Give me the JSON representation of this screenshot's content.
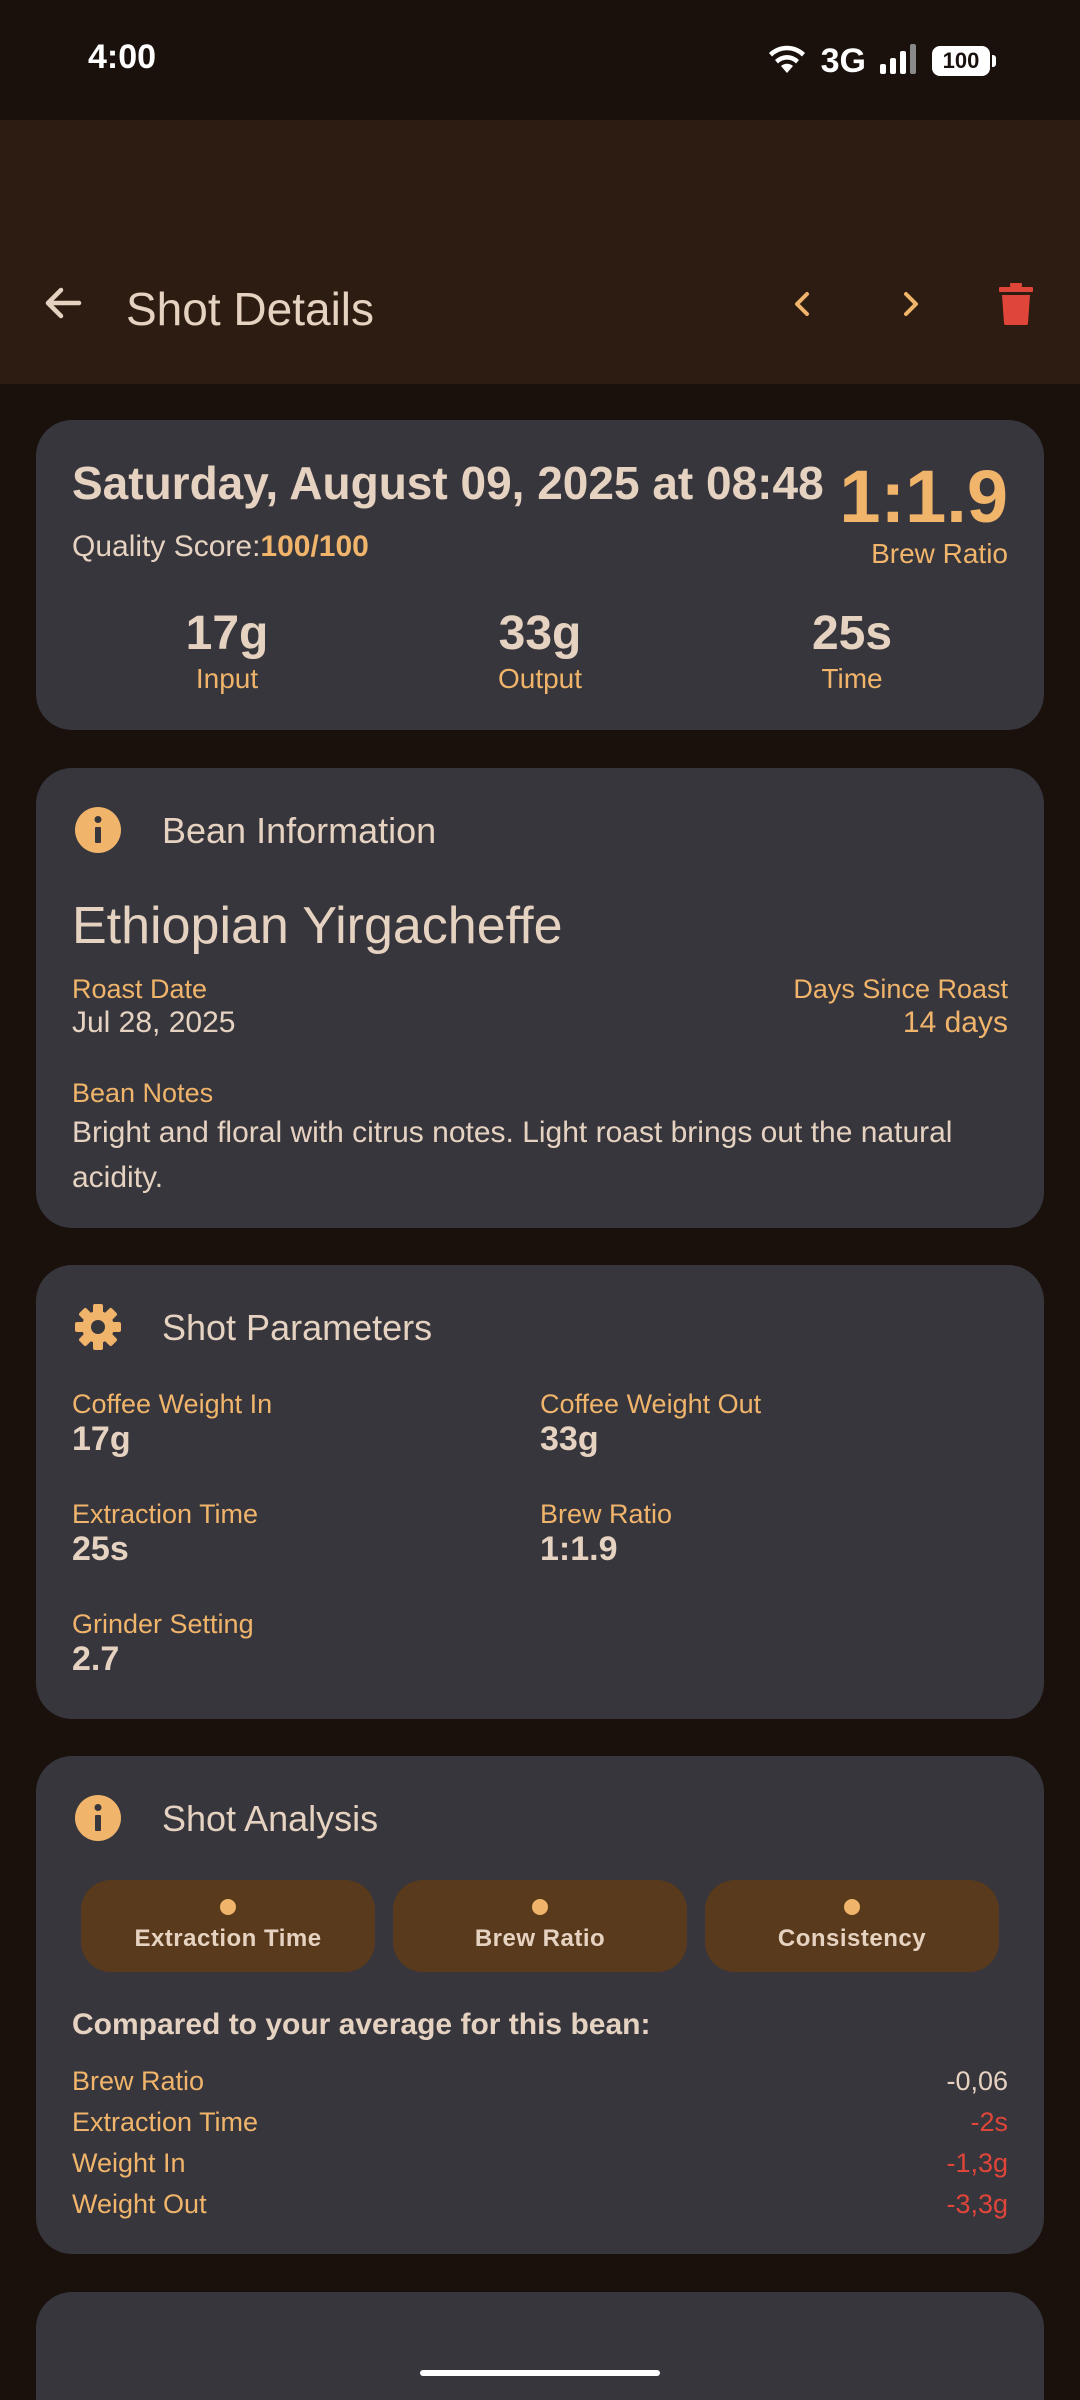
{
  "status": {
    "time": "4:00",
    "network": "3G",
    "battery": "100"
  },
  "app_bar": {
    "title": "Shot Details"
  },
  "summary": {
    "date": "Saturday, August 09, 2025 at 08:48",
    "quality_label": "Quality Score:",
    "quality_value": "100/100",
    "ratio": "1:1.9",
    "ratio_caption": "Brew Ratio",
    "stats": [
      {
        "value": "17g",
        "label": "Input"
      },
      {
        "value": "33g",
        "label": "Output"
      },
      {
        "value": "25s",
        "label": "Time"
      }
    ]
  },
  "bean": {
    "section_title": "Bean Information",
    "name": "Ethiopian Yirgacheffe",
    "roast_date_label": "Roast Date",
    "roast_date": "Jul 28, 2025",
    "days_label": "Days Since Roast",
    "days": "14 days",
    "notes_label": "Bean Notes",
    "notes": "Bright and floral with citrus notes. Light roast brings out the natural acidity."
  },
  "params": {
    "section_title": "Shot Parameters",
    "items": [
      {
        "label": "Coffee Weight In",
        "value": "17g"
      },
      {
        "label": "Coffee Weight Out",
        "value": "33g"
      },
      {
        "label": "Extraction Time",
        "value": "25s"
      },
      {
        "label": "Brew Ratio",
        "value": "1:1.9"
      },
      {
        "label": "Grinder Setting",
        "value": "2.7"
      }
    ]
  },
  "analysis": {
    "section_title": "Shot Analysis",
    "chips": [
      "Extraction Time",
      "Brew Ratio",
      "Consistency"
    ],
    "compare_heading": "Compared to your average for this bean:",
    "rows": [
      {
        "label": "Brew Ratio",
        "value": "-0,06",
        "color": "#e6d2c0"
      },
      {
        "label": "Extraction Time",
        "value": "-2s",
        "color": "#e0453a"
      },
      {
        "label": "Weight In",
        "value": "-1,3g",
        "color": "#e0453a"
      },
      {
        "label": "Weight Out",
        "value": "-3,3g",
        "color": "#e0453a"
      }
    ]
  },
  "colors": {
    "accent": "#f0b46a",
    "danger": "#e0453a",
    "card": "#37363d",
    "app_bar": "#2d1c12",
    "background": "#1a110d"
  }
}
